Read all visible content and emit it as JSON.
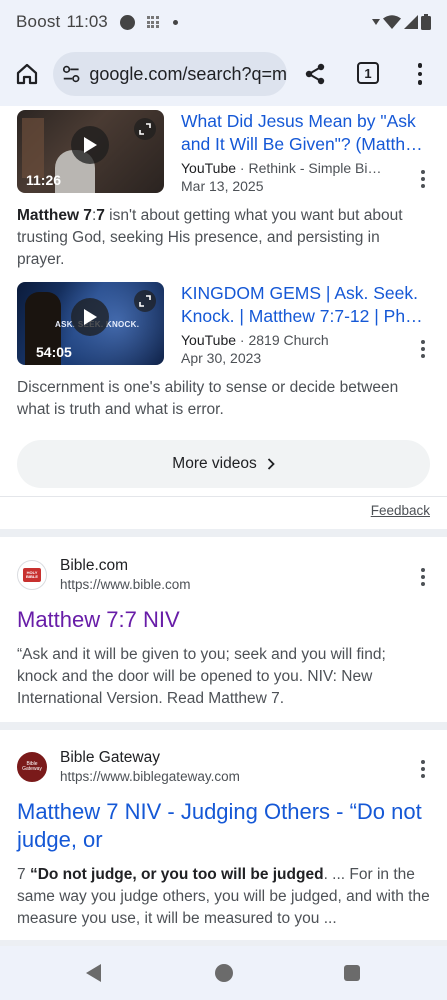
{
  "status_bar": {
    "carrier": "Boost",
    "time": "11:03"
  },
  "toolbar": {
    "url": "google.com/search?q=m",
    "tab_count": "1"
  },
  "videos": [
    {
      "title_line1": "What Did Jesus Mean by \"Ask",
      "title_line2": "and It Will Be Given\"? (Matthe...",
      "source": "YouTube",
      "channel": "· Rethink - Simple Bible T...",
      "date": "Mar 13, 2025",
      "duration": "11:26",
      "snippet_bold": "Matthew 7",
      "snippet_mid": ":",
      "snippet_bold2": "7",
      "snippet_rest": " isn't about getting what you want but about trusting God, seeking His presence, and persisting in prayer."
    },
    {
      "title_line1": "KINGDOM GEMS | Ask. Seek.",
      "title_line2": "Knock. | Matthew 7:7-12 | Phili...",
      "source": "YouTube",
      "channel": "· 2819 Church",
      "date": "Apr 30, 2023",
      "duration": "54:05",
      "thumb_text": "ASK. SEEK. KNOCK.",
      "snippet_rest": "Discernment is one's ability to sense or decide between what is truth and what is error."
    }
  ],
  "more_videos_label": "More videos",
  "feedback_label": "Feedback",
  "results": [
    {
      "site_name": "Bible.com",
      "site_url": "https://www.bible.com",
      "favicon_text": "HOLY BIBLE",
      "title": "Matthew 7:7 NIV",
      "snippet": "“Ask and it will be given to you; seek and you will find; knock and the door will be opened to you. NIV: New International Version. Read Matthew 7."
    },
    {
      "site_name": "Bible Gateway",
      "site_url": "https://www.biblegateway.com",
      "favicon_text": "Bible Gateway",
      "title_line1": "Matthew 7 NIV - Judging Others - “Do not",
      "title_line2": "judge, or",
      "snippet_pre": "7 ",
      "snippet_bold": "“Do not judge, or you too will be judged",
      "snippet_rest": ". ... For in the same way you judge others, you will be judged, and with the measure you use, it will be measured to you ..."
    }
  ],
  "colors": {
    "link": "#1558d6",
    "visited": "#681da8",
    "chrome_bg": "#eef2fa"
  }
}
